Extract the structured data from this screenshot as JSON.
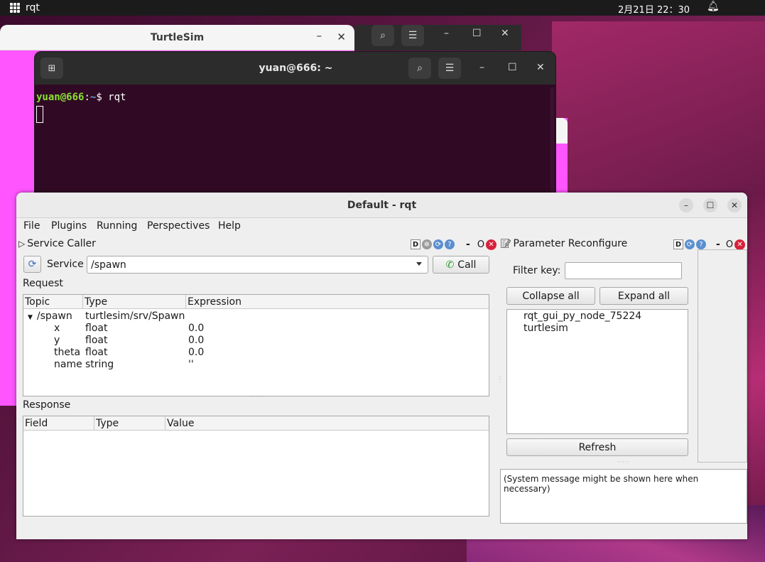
{
  "topbar": {
    "app_name": "rqt",
    "clock": "2月21日  22：30"
  },
  "turtlesim": {
    "title": "TurtleSim"
  },
  "terminal": {
    "title": "yuan@666: ~",
    "prompt_user": "yuan@666",
    "prompt_sep": ":",
    "prompt_path": "~",
    "prompt_symbol": "$ ",
    "command": "rqt"
  },
  "rqt": {
    "title": "Default - rqt",
    "menu": {
      "file": "File",
      "plugins": "Plugins",
      "running": "Running",
      "perspectives": "Perspectives",
      "help": "Help"
    },
    "service_caller": {
      "title": "Service Caller",
      "service_label": "Service",
      "service_value": "/spawn",
      "call_label": "Call",
      "request_label": "Request",
      "request_columns": [
        "Topic",
        "Type",
        "Expression"
      ],
      "request_rows": [
        {
          "topic": "/spawn",
          "type": "turtlesim/srv/Spawn",
          "expr": ""
        },
        {
          "topic": "x",
          "type": "float",
          "expr": "0.0"
        },
        {
          "topic": "y",
          "type": "float",
          "expr": "0.0"
        },
        {
          "topic": "theta",
          "type": "float",
          "expr": "0.0"
        },
        {
          "topic": "name",
          "type": "string",
          "expr": "''"
        }
      ],
      "response_label": "Response",
      "response_columns": [
        "Field",
        "Type",
        "Value"
      ]
    },
    "param_reconfigure": {
      "title": "Parameter Reconfigure",
      "filter_label": "Filter key:",
      "filter_value": "",
      "collapse_all": "Collapse all",
      "expand_all": "Expand all",
      "nodes": [
        "rqt_gui_py_node_75224",
        "turtlesim"
      ],
      "refresh": "Refresh",
      "system_message": "(System message might be shown here when necessary)"
    },
    "dock_buttons": {
      "d": "D",
      "minus": "-",
      "o": "O"
    }
  },
  "colors": {
    "turtle_bg": "#ff55ff",
    "terminal_bg": "#300a24",
    "close_red": "#d8203a"
  }
}
